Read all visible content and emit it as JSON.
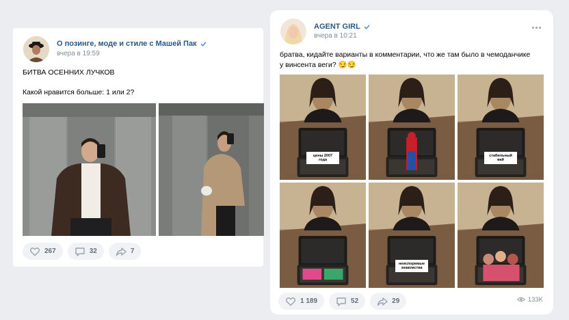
{
  "left_post": {
    "author": "О позинге, моде и стиле с Машей Пак",
    "time": "вчера в 19:59",
    "title": "БИТВА ОСЕННИХ ЛУЧКОВ",
    "question": "Какой нравится больше: 1 или 2?",
    "likes": "267",
    "comments": "32",
    "shares": "7"
  },
  "right_post": {
    "author": "AGENT GIRL",
    "time": "вчера в 10:21",
    "text": "братва, кидайте варианты в комментарии, что же там было в чемоданчике у винсента веги? 😏😏",
    "likes": "1 189",
    "comments": "52",
    "shares": "29",
    "views": "133K",
    "meme_labels": [
      "цены 2007 года",
      "стабильный вай",
      "неиспоримые знакомства"
    ]
  },
  "colors": {
    "link": "#2a5885",
    "bg": "#ebedf0",
    "pill": "#f0f2f5"
  },
  "icons": [
    "verified-icon",
    "heart-icon",
    "comment-icon",
    "share-icon",
    "eye-icon",
    "more-icon"
  ]
}
